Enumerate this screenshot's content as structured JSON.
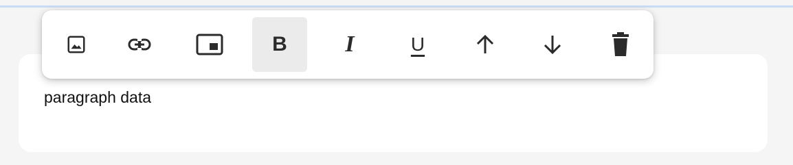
{
  "toolbar": {
    "items": [
      {
        "name": "image",
        "icon": "image-icon",
        "active": false
      },
      {
        "name": "link",
        "icon": "link-icon",
        "active": false
      },
      {
        "name": "picture-in-picture",
        "icon": "picture-in-picture-icon",
        "active": false
      },
      {
        "name": "bold",
        "icon": "bold-icon",
        "label": "B",
        "active": true
      },
      {
        "name": "italic",
        "icon": "italic-icon",
        "label": "I",
        "active": false
      },
      {
        "name": "underline",
        "icon": "underline-icon",
        "label": "U",
        "active": false
      },
      {
        "name": "move-up",
        "icon": "arrow-up-icon",
        "active": false
      },
      {
        "name": "move-down",
        "icon": "arrow-down-icon",
        "active": false
      },
      {
        "name": "delete",
        "icon": "trash-icon",
        "active": false
      }
    ]
  },
  "editor": {
    "paragraph_text": "paragraph data"
  },
  "colors": {
    "background": "#f5f5f5",
    "accent_rule": "#c9dcf5",
    "icon": "#2b2b2b",
    "active_bg": "#ebebeb"
  }
}
